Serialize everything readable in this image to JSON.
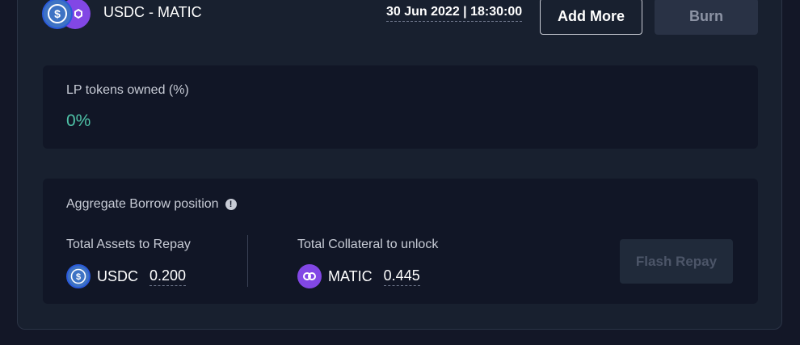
{
  "header": {
    "pair_name": "USDC - MATIC",
    "date": "30 Jun 2022 | 18:30:00",
    "add_more_label": "Add More",
    "burn_label": "Burn"
  },
  "lp": {
    "label": "LP tokens owned (%)",
    "value": "0%"
  },
  "borrow": {
    "title": "Aggregate Borrow position",
    "info_icon": "!",
    "repay": {
      "label": "Total Assets to Repay",
      "symbol": "USDC",
      "amount": "0.200"
    },
    "collateral": {
      "label": "Total Collateral to unlock",
      "symbol": "MATIC",
      "amount": "0.445"
    },
    "flash_repay_label": "Flash Repay"
  },
  "icons": {
    "usdc": "usdc-icon",
    "matic": "matic-icon",
    "info": "info-icon"
  },
  "colors": {
    "accent_green": "#4fc3a8",
    "usdc_blue": "#3e73c4",
    "matic_purple": "#8247e5"
  }
}
